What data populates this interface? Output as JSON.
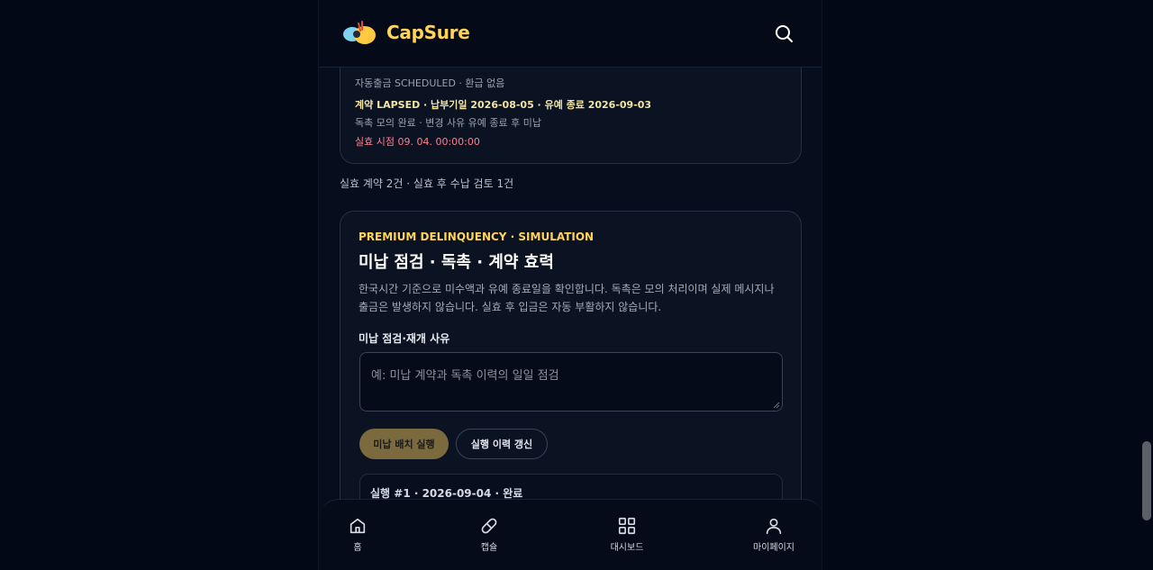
{
  "header": {
    "brand": "CapSure",
    "logo_icon": "capsule-logo-icon",
    "search_icon": "search-icon"
  },
  "status_card": {
    "line1": "자동출금 SCHEDULED · 환급 없음",
    "line2": "계약 LAPSED · 납부기일 2026-08-05 · 유예 종료 2026-09-03",
    "line3": "독촉 모의 완료 · 변경 사유 유예 종료 후 미납",
    "line4": "실효 시점 09. 04. 00:00:00"
  },
  "summary": "실효 계약 2건 · 실효 후 수납 검토 1건",
  "delinquency": {
    "eyebrow": "PREMIUM DELINQUENCY · SIMULATION",
    "title": "미납 점검 · 독촉 · 계약 효력",
    "description": "한국시간 기준으로 미수액과 유예 종료일을 확인합니다. 독촉은 모의 처리이며 실제 메시지나 출금은 발생하지 않습니다. 실효 후 입금은 자동 부활하지 않습니다.",
    "reason_label": "미납 점검·재개 사유",
    "reason_placeholder": "예: 미납 계약과 독촉 이력의 일일 점검",
    "run_button": "미납 배치 실행",
    "refresh_button": "실행 이력 갱신",
    "run_history_title": "실행 #1 · 2026-09-04 · 완료"
  },
  "bottom_nav": [
    {
      "label": "홈",
      "icon": "home-icon"
    },
    {
      "label": "캡슐",
      "icon": "pill-icon"
    },
    {
      "label": "대시보드",
      "icon": "dashboard-icon"
    },
    {
      "label": "마이페이지",
      "icon": "user-icon"
    }
  ],
  "colors": {
    "accent": "#ffd35c",
    "danger": "#ff7f8c",
    "background": "#060d1c"
  }
}
